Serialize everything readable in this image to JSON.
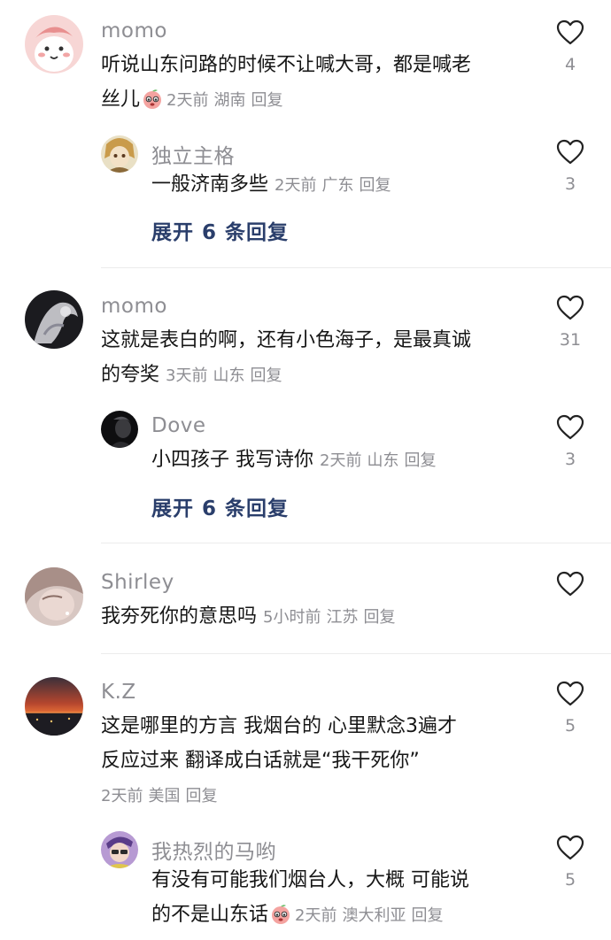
{
  "comments": [
    {
      "username": "momo",
      "text_line1": "听说山东问路的时候不让喊大哥，都是喊老",
      "text_line2": "丝儿",
      "time": "2天前",
      "location": "湖南",
      "reply_label": "回复",
      "likes": "4",
      "avatar_icon": "pink-cartoon-avatar"
    },
    {
      "username": "独立主格",
      "text": "一般济南多些",
      "time": "2天前",
      "location": "广东",
      "reply_label": "回复",
      "likes": "3",
      "expand_label": "展开 6 条回复",
      "avatar_icon": "anime-character-avatar"
    },
    {
      "username": "momo",
      "text_line1": "这就是表白的啊，还有小色海子，是最真诚",
      "text_line2": "的夸奖",
      "time": "3天前",
      "location": "山东",
      "reply_label": "回复",
      "likes": "31",
      "avatar_icon": "dark-artistic-avatar"
    },
    {
      "username": "Dove",
      "text": "小四孩子 我写诗你",
      "time": "2天前",
      "location": "山东",
      "reply_label": "回复",
      "likes": "3",
      "expand_label": "展开 6 条回复",
      "avatar_icon": "dark-portrait-avatar"
    },
    {
      "username": "Shirley",
      "text": "我夯死你的意思吗",
      "time": "5小时前",
      "location": "江苏",
      "reply_label": "回复",
      "likes": "",
      "avatar_icon": "portrait-photo-avatar"
    },
    {
      "username": "K.Z",
      "text_line1": "这是哪里的方言 我烟台的 心里默念3遍才",
      "text_line2": "反应过来 翻译成白话就是“我干死你”",
      "time": "2天前",
      "location": "美国",
      "reply_label": "回复",
      "likes": "5",
      "avatar_icon": "sunset-landscape-avatar"
    },
    {
      "username": "我热烈的马哟",
      "text_line1": "有没有可能我们烟台人，大概 可能说",
      "text_line2": "的不是山东话",
      "time": "2天前",
      "location": "澳大利亚",
      "reply_label": "回复",
      "likes": "5",
      "avatar_icon": "purple-character-avatar"
    }
  ],
  "colors": {
    "username": "#8e8e93",
    "text": "#161616",
    "meta": "#8e8e93",
    "expand": "#2a3e6b",
    "divider": "#ececec"
  },
  "icons": {
    "like": "heart-outline-icon",
    "emoji": "crying-peach-emoji"
  }
}
